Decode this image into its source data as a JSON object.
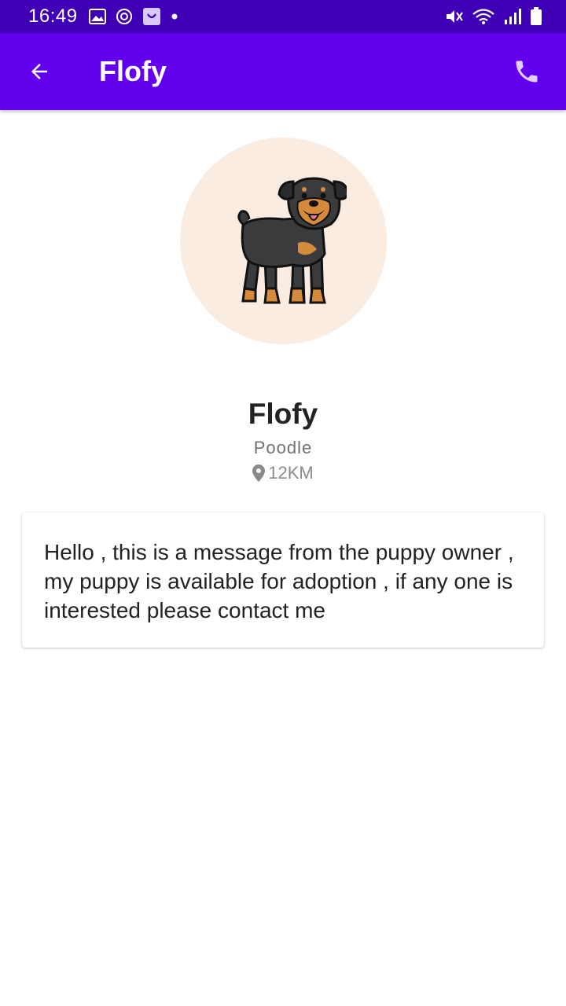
{
  "status_bar": {
    "time": "16:49",
    "icons": [
      "image-icon",
      "sync-icon",
      "shop-icon",
      "dot-icon",
      "mute-icon",
      "wifi-icon",
      "signal-icon",
      "battery-icon"
    ]
  },
  "app_bar": {
    "title": "Flofy",
    "back_icon": "arrow-back-icon",
    "call_icon": "phone-icon",
    "color": "#6200ee"
  },
  "pet": {
    "name": "Flofy",
    "breed": "Poodle",
    "distance": "12KM",
    "avatar_bg": "#faece1"
  },
  "message": {
    "text": "Hello , this is a message from the puppy owner , my puppy is available for adoption , if any one is interested please contact me"
  }
}
